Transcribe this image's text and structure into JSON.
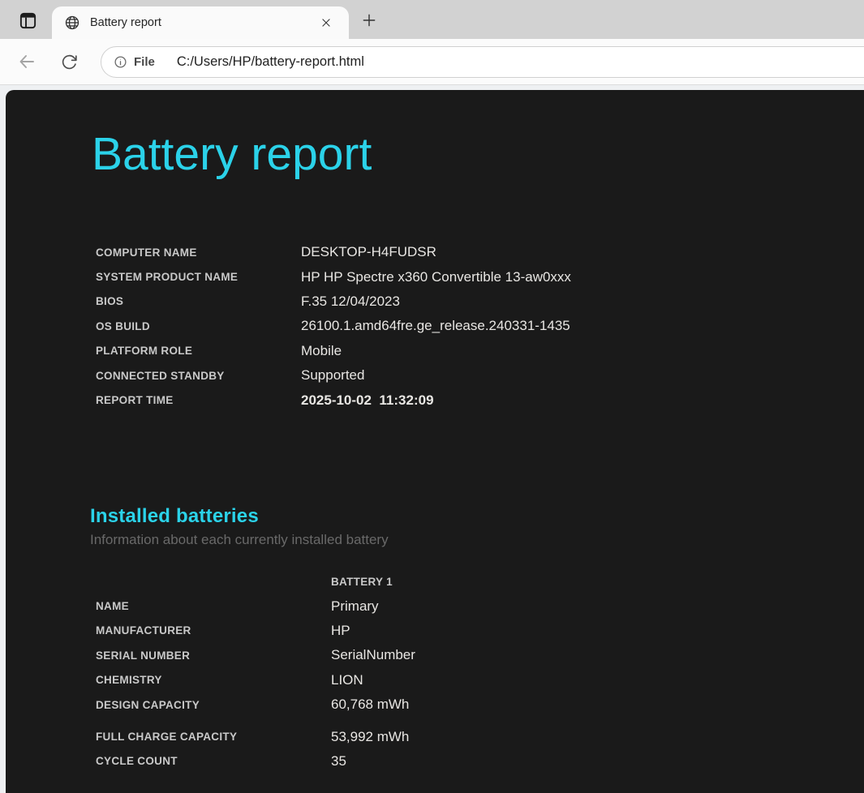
{
  "browser": {
    "tab_title": "Battery report",
    "address": {
      "scheme_label": "File",
      "url": "C:/Users/HP/battery-report.html"
    }
  },
  "icons": {
    "tab_actions": "window-layout",
    "tab_favicon": "globe",
    "close": "×",
    "new_tab": "+",
    "back": "←",
    "refresh": "↻",
    "url_info": "ⓘ"
  },
  "colors": {
    "accent_cyan": "#2bd2e9",
    "page_background": "#1a1a1a",
    "tabstrip_gray": "#d2d2d2",
    "toolbar_white": "#fbfbfb"
  },
  "page": {
    "title": "Battery report",
    "system_info_rows": [
      {
        "label": "COMPUTER NAME",
        "value": "DESKTOP-H4FUDSR"
      },
      {
        "label": "SYSTEM PRODUCT NAME",
        "value": "HP HP Spectre x360 Convertible 13-aw0xxx"
      },
      {
        "label": "BIOS",
        "value": "F.35 12/04/2023"
      },
      {
        "label": "OS BUILD",
        "value": "26100.1.amd64fre.ge_release.240331-1435"
      },
      {
        "label": "PLATFORM ROLE",
        "value": "Mobile"
      },
      {
        "label": "CONNECTED STANDBY",
        "value": "Supported"
      },
      {
        "label": "REPORT TIME",
        "value": "2025-10-02  11:32:09"
      }
    ],
    "installed_batteries": {
      "heading": "Installed batteries",
      "subtitle": "Information about each currently installed battery",
      "column_header": "BATTERY 1",
      "rows": [
        {
          "label": "NAME",
          "value": "Primary"
        },
        {
          "label": "MANUFACTURER",
          "value": "HP"
        },
        {
          "label": "SERIAL NUMBER",
          "value": "SerialNumber"
        },
        {
          "label": "CHEMISTRY",
          "value": "LION"
        },
        {
          "label": "DESIGN CAPACITY",
          "value": "60,768 mWh"
        }
      ],
      "rows_secondary": [
        {
          "label": "FULL CHARGE CAPACITY",
          "value": "53,992 mWh"
        },
        {
          "label": "CYCLE COUNT",
          "value": "35"
        }
      ]
    }
  }
}
